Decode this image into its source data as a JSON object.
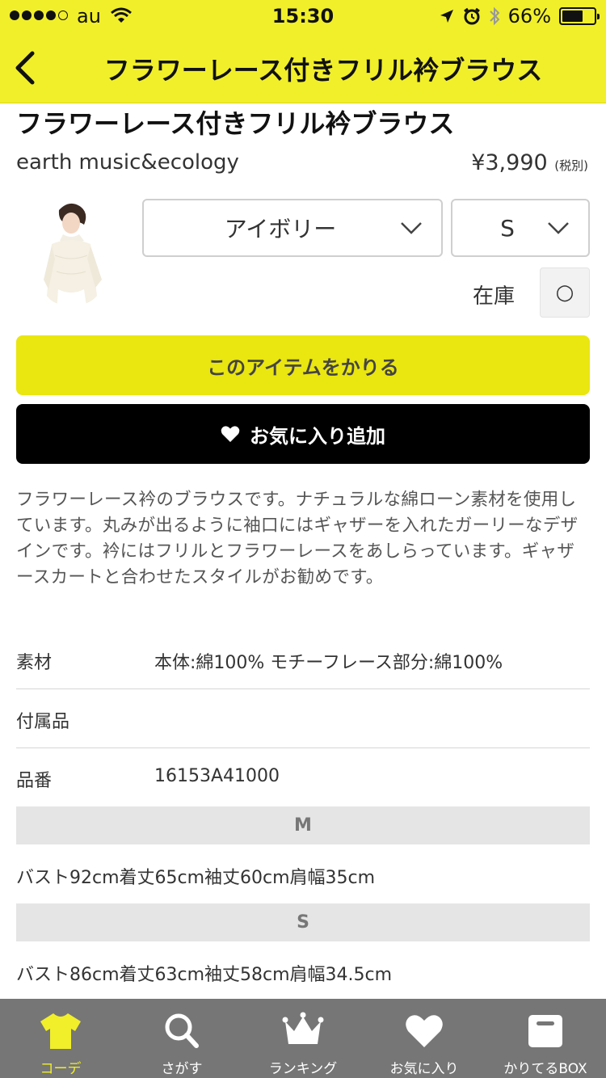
{
  "status_bar": {
    "carrier": "au",
    "time": "15:30",
    "battery": "66%",
    "battery_level": 0.66
  },
  "nav": {
    "title": "フラワーレース付きフリル衿ブラウス"
  },
  "product": {
    "name": "フラワーレース付きフリル衿ブラウス",
    "brand": "earth music&ecology",
    "price": "¥3,990",
    "tax_note": "(税別)",
    "color_select": "アイボリー",
    "size_select": "S",
    "stock_label": "在庫",
    "stock_status": "○"
  },
  "buttons": {
    "rent": "このアイテムをかりる",
    "favorite": "お気に入り追加"
  },
  "description": "フラワーレース衿のブラウスです。ナチュラルな綿ローン素材を使用しています。丸みが出るように袖口にはギャザーを入れたガーリーなデザインです。衿にはフリルとフラワーレースをあしらっています。ギャザースカートと合わせたスタイルがお勧めです。",
  "specs": [
    {
      "label": "素材",
      "value": "本体:綿100% モチーフレース部分:綿100%"
    },
    {
      "label": "付属品",
      "value": ""
    },
    {
      "label": "品番",
      "value": "16153A41000"
    }
  ],
  "sizes": [
    {
      "name": "M",
      "detail": "バスト92cm着丈65cm袖丈60cm肩幅35cm"
    },
    {
      "name": "S",
      "detail": "バスト86cm着丈63cm袖丈58cm肩幅34.5cm"
    }
  ],
  "tabbar": {
    "items": [
      {
        "label": "コーデ",
        "icon": "tshirt-icon",
        "active": true
      },
      {
        "label": "さがす",
        "icon": "search-icon"
      },
      {
        "label": "ランキング",
        "icon": "crown-icon"
      },
      {
        "label": "お気に入り",
        "icon": "heart-icon"
      },
      {
        "label": "かりてるBOX",
        "icon": "box-icon"
      }
    ]
  },
  "colors": {
    "accent_yellow": "#f1ef2a",
    "rent_button": "#eae610",
    "tabbar_bg": "#767676"
  }
}
